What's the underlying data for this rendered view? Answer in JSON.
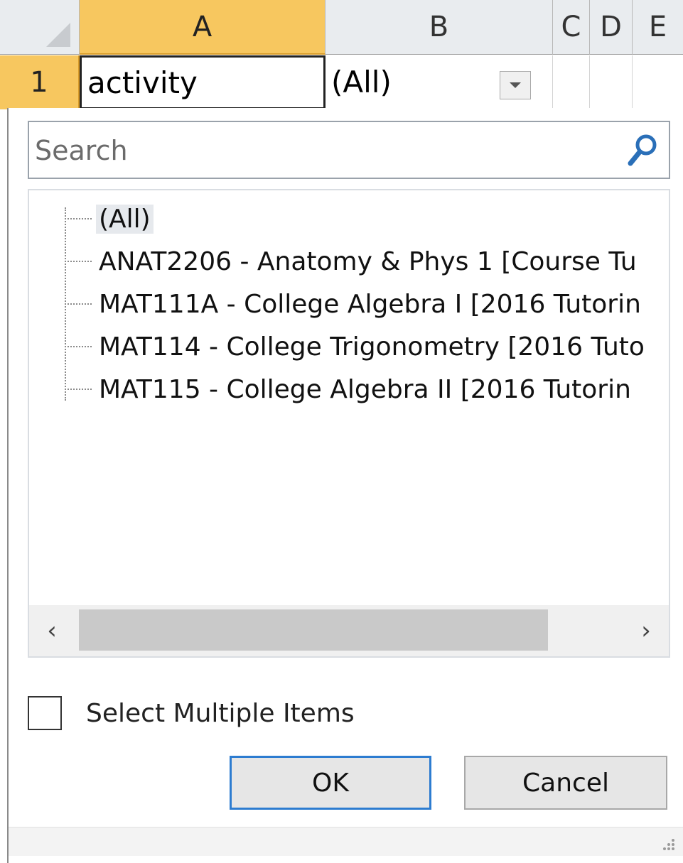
{
  "sheet": {
    "columns": [
      "A",
      "B",
      "C",
      "D",
      "E"
    ],
    "row_number": "1",
    "cell_a1": "activity",
    "cell_b1": "(All)"
  },
  "filter": {
    "search_placeholder": "Search",
    "items": [
      "(All)",
      "ANAT2206 - Anatomy & Phys 1 [Course Tu",
      "MAT111A - College Algebra I [2016 Tutorin",
      "MAT114 - College Trigonometry [2016 Tuto",
      "MAT115 - College Algebra II [2016 Tutorin"
    ],
    "select_multiple_label": "Select Multiple Items",
    "ok_label": "OK",
    "cancel_label": "Cancel"
  },
  "colors": {
    "selected_header": "#f7c75f",
    "ok_focus_border": "#2d7cd0"
  },
  "icons": {
    "search": "magnifier-icon",
    "scroll_left": "chevron-left-icon",
    "scroll_right": "chevron-right-icon",
    "dropdown": "chevron-down-icon"
  }
}
